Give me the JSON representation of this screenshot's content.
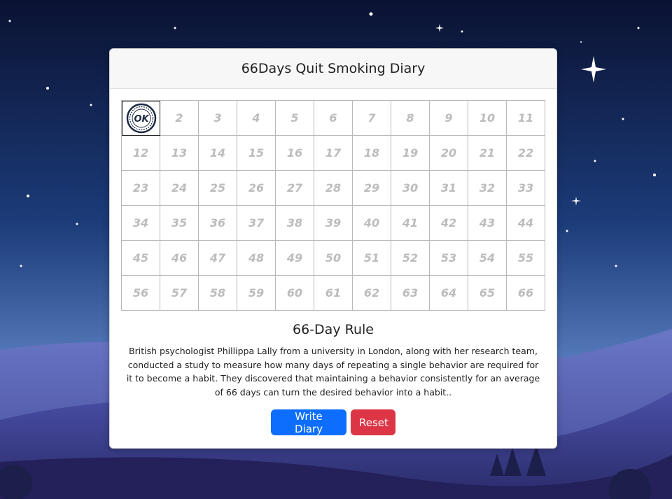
{
  "page": {
    "title": "66Days Quit Smoking Diary"
  },
  "calendar": {
    "checked_days": [
      1
    ],
    "stamp_text": "OK",
    "days": [
      "1",
      "2",
      "3",
      "4",
      "5",
      "6",
      "7",
      "8",
      "9",
      "10",
      "11",
      "12",
      "13",
      "14",
      "15",
      "16",
      "17",
      "18",
      "19",
      "20",
      "21",
      "22",
      "23",
      "24",
      "25",
      "26",
      "27",
      "28",
      "29",
      "30",
      "31",
      "32",
      "33",
      "34",
      "35",
      "36",
      "37",
      "38",
      "39",
      "40",
      "41",
      "42",
      "43",
      "44",
      "45",
      "46",
      "47",
      "48",
      "49",
      "50",
      "51",
      "52",
      "53",
      "54",
      "55",
      "56",
      "57",
      "58",
      "59",
      "60",
      "61",
      "62",
      "63",
      "64",
      "65",
      "66"
    ]
  },
  "rule": {
    "title": "66-Day Rule",
    "text": "British psychologist Phillippa Lally from a university in London, along with her research team, conducted a study to measure how many days of repeating a single behavior are required for it to become a habit. They discovered that maintaining a behavior consistently for an average of 66 days can turn the desired behavior into a habit.."
  },
  "actions": {
    "write_label": "Write Diary",
    "reset_label": "Reset"
  },
  "colors": {
    "primary": "#0d6efd",
    "danger": "#dc3545",
    "day_number": "#bcbcbc"
  }
}
